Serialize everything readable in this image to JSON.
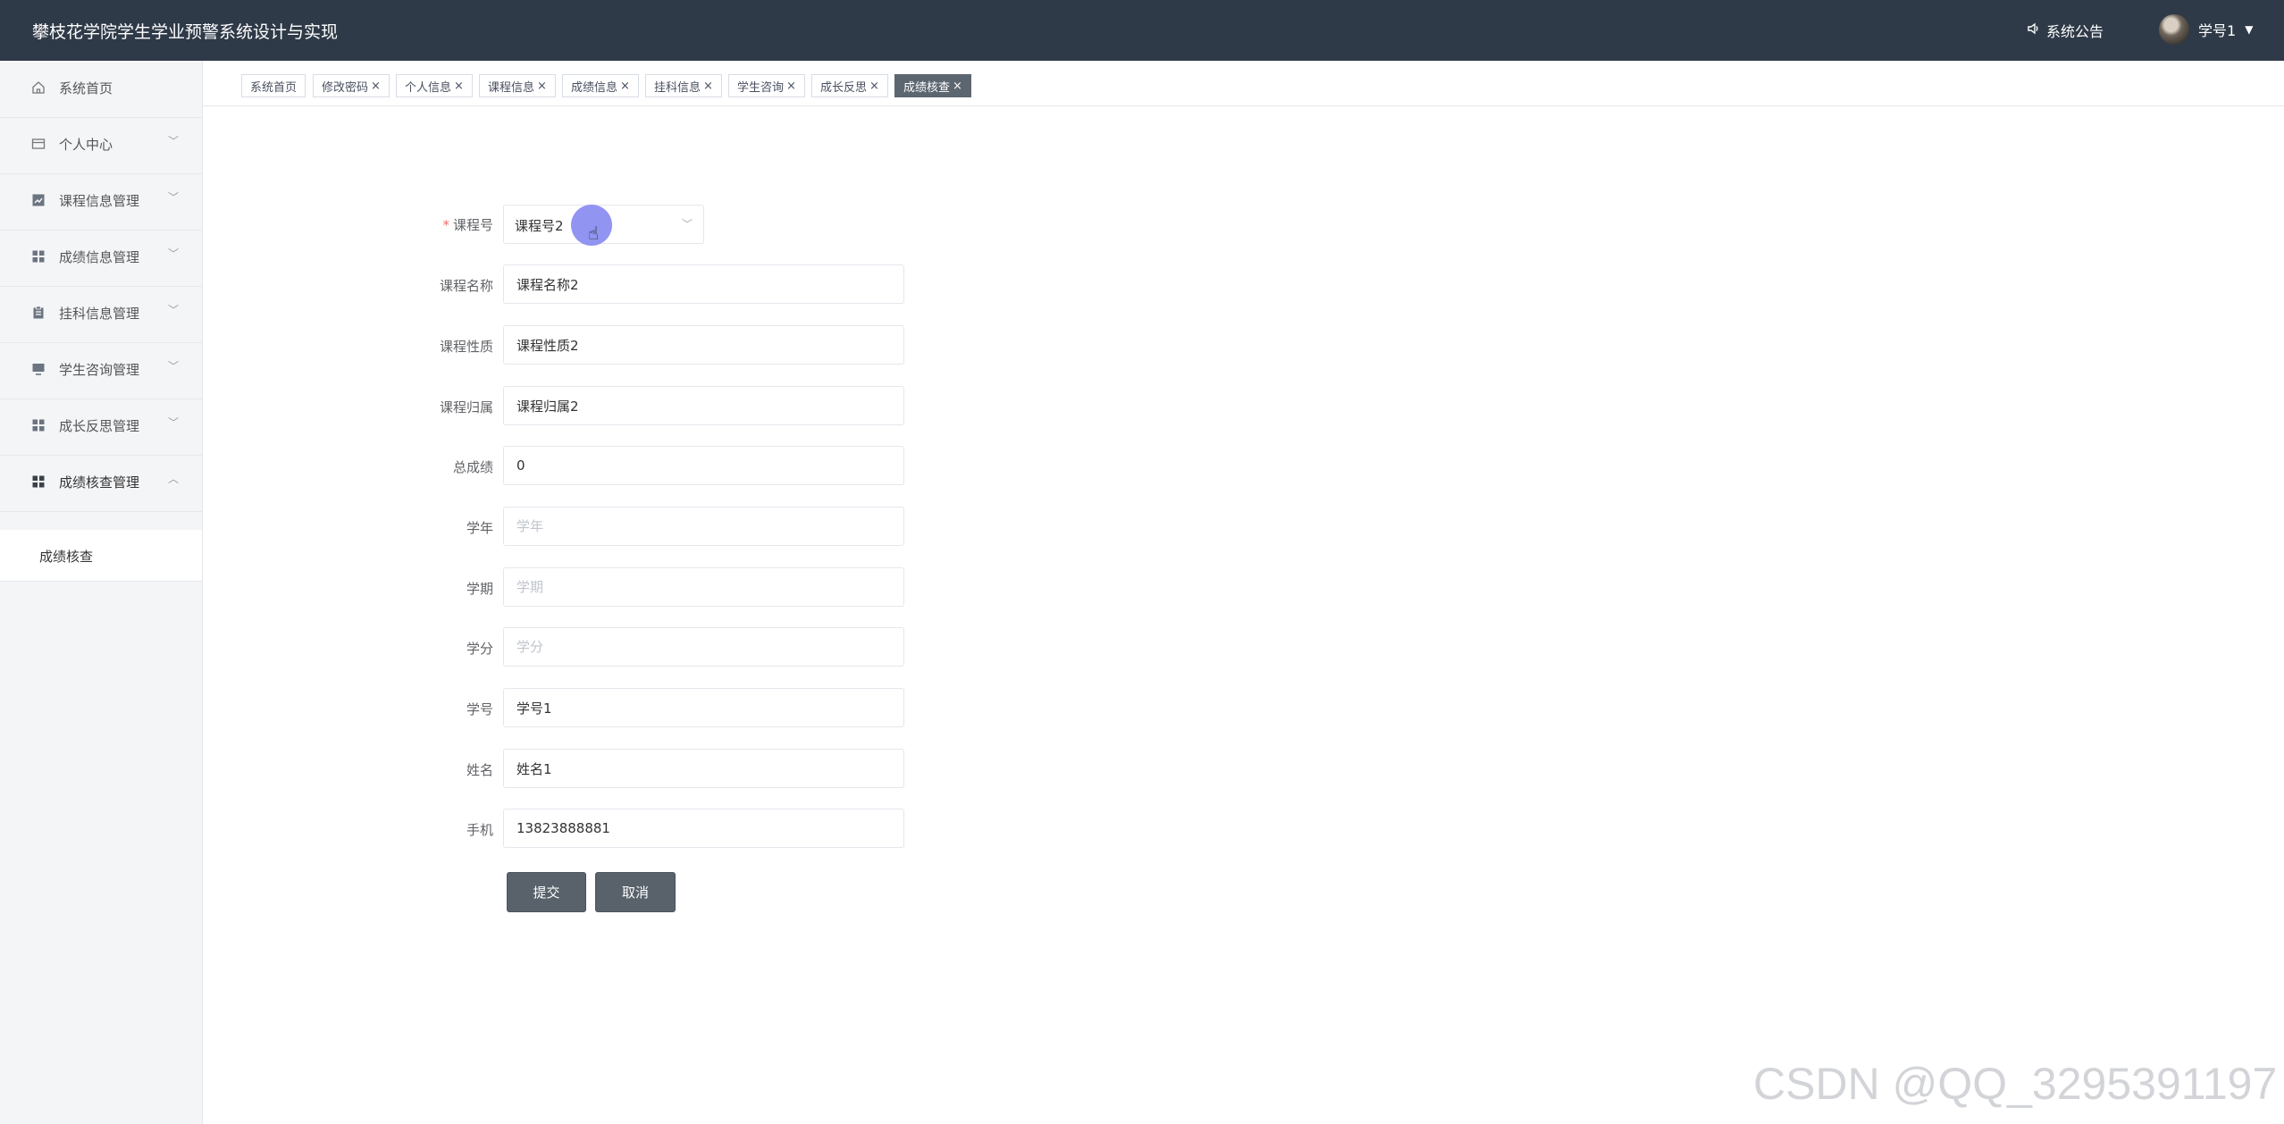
{
  "header": {
    "title": "攀枝花学院学生学业预警系统设计与实现",
    "notice_label": "系统公告",
    "user_label": "学号1"
  },
  "sidebar": {
    "items": [
      {
        "label": "系统首页",
        "icon": "home-icon",
        "has_arrow": false
      },
      {
        "label": "个人中心",
        "icon": "id-card-icon",
        "has_arrow": true
      },
      {
        "label": "课程信息管理",
        "icon": "chart-icon",
        "has_arrow": true
      },
      {
        "label": "成绩信息管理",
        "icon": "grid-icon",
        "has_arrow": true
      },
      {
        "label": "挂科信息管理",
        "icon": "clipboard-icon",
        "has_arrow": true
      },
      {
        "label": "学生咨询管理",
        "icon": "monitor-icon",
        "has_arrow": true
      },
      {
        "label": "成长反思管理",
        "icon": "grid-icon",
        "has_arrow": true
      },
      {
        "label": "成绩核查管理",
        "icon": "grid-icon",
        "has_arrow": true,
        "expanded": true
      }
    ],
    "subitem": "成绩核查"
  },
  "tabs": [
    {
      "label": "系统首页",
      "closable": false,
      "active": false
    },
    {
      "label": "修改密码",
      "closable": true,
      "active": false
    },
    {
      "label": "个人信息",
      "closable": true,
      "active": false
    },
    {
      "label": "课程信息",
      "closable": true,
      "active": false
    },
    {
      "label": "成绩信息",
      "closable": true,
      "active": false
    },
    {
      "label": "挂科信息",
      "closable": true,
      "active": false
    },
    {
      "label": "学生咨询",
      "closable": true,
      "active": false
    },
    {
      "label": "成长反思",
      "closable": true,
      "active": false
    },
    {
      "label": "成绩核查",
      "closable": true,
      "active": true
    }
  ],
  "form": {
    "course_no": {
      "label": "课程号",
      "value": "课程号2",
      "required": true
    },
    "course_name": {
      "label": "课程名称",
      "value": "课程名称2"
    },
    "course_type": {
      "label": "课程性质",
      "value": "课程性质2"
    },
    "course_owner": {
      "label": "课程归属",
      "value": "课程归属2"
    },
    "total_score": {
      "label": "总成绩",
      "value": "0"
    },
    "school_year": {
      "label": "学年",
      "value": "",
      "placeholder": "学年"
    },
    "semester": {
      "label": "学期",
      "value": "",
      "placeholder": "学期"
    },
    "credit": {
      "label": "学分",
      "value": "",
      "placeholder": "学分"
    },
    "student_no": {
      "label": "学号",
      "value": "学号1"
    },
    "student_name": {
      "label": "姓名",
      "value": "姓名1"
    },
    "phone": {
      "label": "手机",
      "value": "13823888881"
    }
  },
  "buttons": {
    "submit": "提交",
    "cancel": "取消"
  },
  "watermark": "CSDN @QQ_3295391197",
  "colors": {
    "header_bg": "#2f3a48",
    "button_bg": "#59626b",
    "active_tab": "#5c6670",
    "cursor_dot": "#8b8ef0"
  }
}
